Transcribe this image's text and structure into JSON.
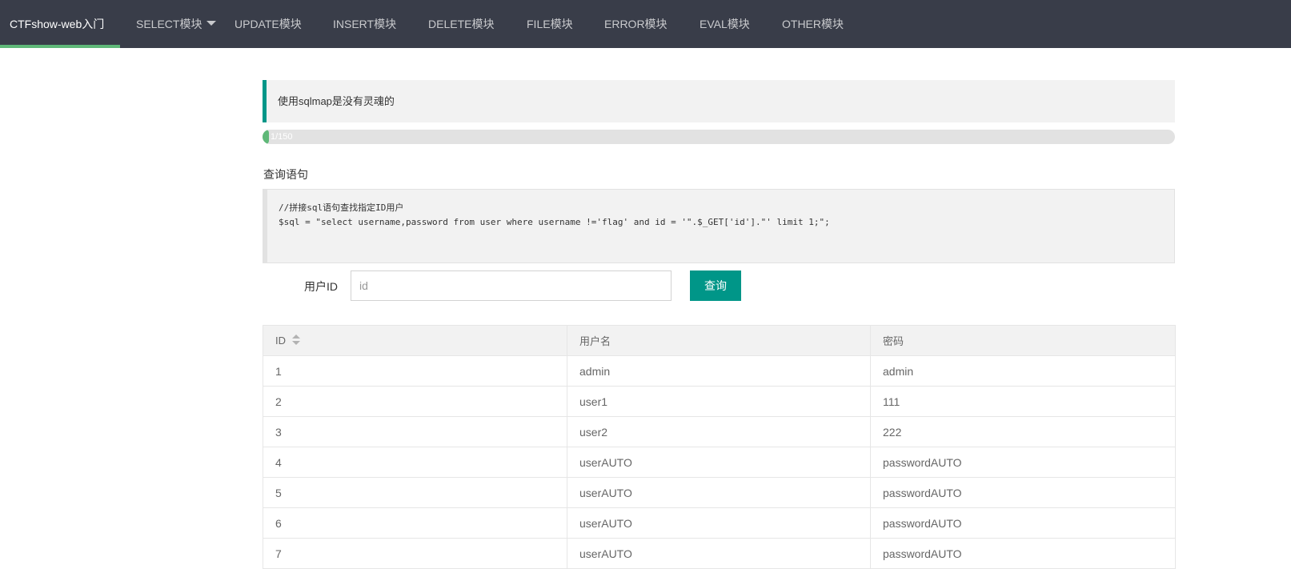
{
  "nav": {
    "brand": "CTFshow-web入门",
    "items": [
      {
        "label": "SELECT模块",
        "has_dropdown": true
      },
      {
        "label": "UPDATE模块"
      },
      {
        "label": "INSERT模块"
      },
      {
        "label": "DELETE模块"
      },
      {
        "label": "FILE模块"
      },
      {
        "label": "ERROR模块"
      },
      {
        "label": "EVAL模块"
      },
      {
        "label": "OTHER模块"
      }
    ]
  },
  "notice": {
    "text": "使用sqlmap是没有灵魂的"
  },
  "progress": {
    "text": "1/150",
    "value": 1,
    "max": 150
  },
  "query_section": {
    "label": "查询语句",
    "code_lines": [
      "//拼接sql语句查找指定ID用户",
      "$sql = \"select username,password from user where username !='flag' and id = '\".$_GET['id'].\"' limit 1;\";"
    ]
  },
  "form": {
    "label": "用户ID",
    "input_value": "",
    "input_placeholder": "id",
    "button_label": "查询"
  },
  "table": {
    "columns": [
      "ID",
      "用户名",
      "密码"
    ],
    "rows": [
      [
        "1",
        "admin",
        "admin"
      ],
      [
        "2",
        "user1",
        "111"
      ],
      [
        "3",
        "user2",
        "222"
      ],
      [
        "4",
        "userAUTO",
        "passwordAUTO"
      ],
      [
        "5",
        "userAUTO",
        "passwordAUTO"
      ],
      [
        "6",
        "userAUTO",
        "passwordAUTO"
      ],
      [
        "7",
        "userAUTO",
        "passwordAUTO"
      ]
    ]
  },
  "colors": {
    "nav_bg": "#393d49",
    "accent_green": "#5fb878",
    "primary_teal": "#009688",
    "panel_bg": "#f2f2f2"
  },
  "icons": {
    "dropdown": "caret-down-icon",
    "sort": "sort-icon"
  }
}
